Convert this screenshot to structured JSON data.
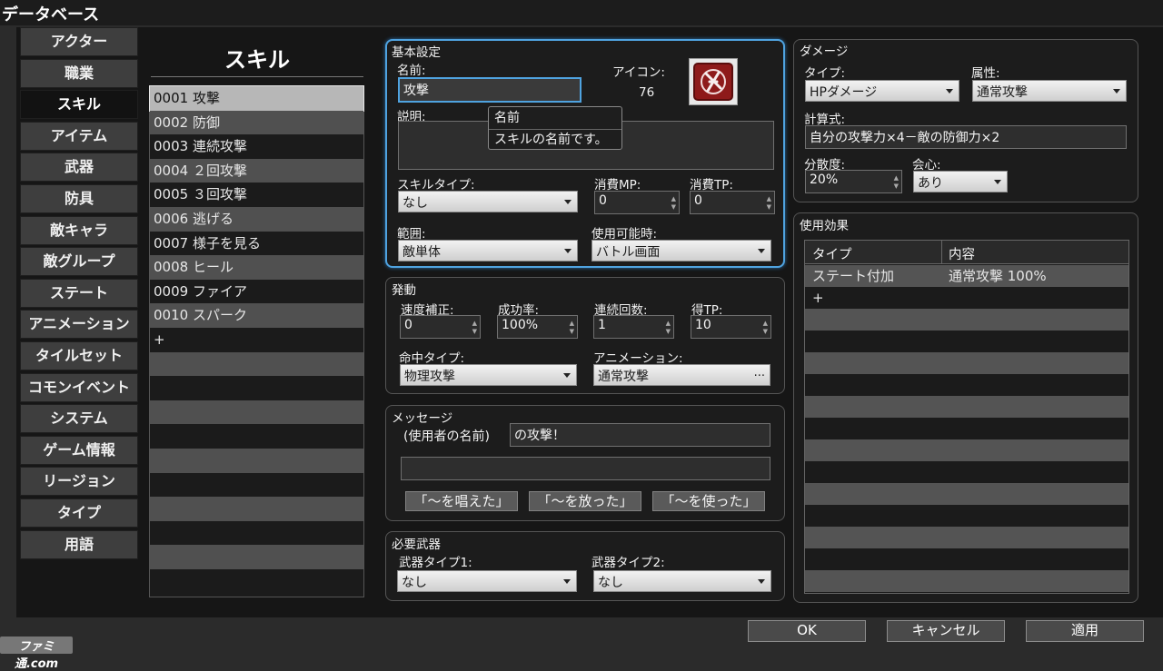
{
  "window": {
    "title": "データベース"
  },
  "sidebar": {
    "selected_index": 2,
    "items": [
      "アクター",
      "職業",
      "スキル",
      "アイテム",
      "武器",
      "防具",
      "敵キャラ",
      "敵グループ",
      "ステート",
      "アニメーション",
      "タイルセット",
      "コモンイベント",
      "システム",
      "ゲーム情報",
      "リージョン",
      "タイプ",
      "用語"
    ]
  },
  "skill_list": {
    "title": "スキル",
    "selected_index": 0,
    "items": [
      "0001 攻撃",
      "0002 防御",
      "0003 連続攻撃",
      "0004 ２回攻撃",
      "0005 ３回攻撃",
      "0006 逃げる",
      "0007 様子を見る",
      "0008 ヒール",
      "0009 ファイア",
      "0010 スパーク"
    ],
    "add_symbol": "+"
  },
  "basic": {
    "section_title": "基本設定",
    "name_label": "名前:",
    "name_value": "攻撃",
    "icon_label": "アイコン:",
    "icon_index": "76",
    "description_label": "説明:",
    "description_value": "",
    "skill_type_label": "スキルタイプ:",
    "skill_type_value": "なし",
    "mp_cost_label": "消費MP:",
    "mp_cost_value": "0",
    "tp_cost_label": "消費TP:",
    "tp_cost_value": "0",
    "scope_label": "範囲:",
    "scope_value": "敵単体",
    "occasion_label": "使用可能時:",
    "occasion_value": "バトル画面"
  },
  "tooltip": {
    "title": "名前",
    "text": "スキルの名前です。"
  },
  "invocation": {
    "section_title": "発動",
    "speed_label": "速度補正:",
    "speed_value": "0",
    "success_label": "成功率:",
    "success_value": "100%",
    "repeats_label": "連続回数:",
    "repeats_value": "1",
    "tp_gain_label": "得TP:",
    "tp_gain_value": "10",
    "hit_type_label": "命中タイプ:",
    "hit_type_value": "物理攻撃",
    "animation_label": "アニメーション:",
    "animation_value": "通常攻撃",
    "ellipsis": "..."
  },
  "message": {
    "section_title": "メッセージ",
    "user_name_label": "(使用者の名前)",
    "line1": "の攻撃！",
    "line2": "",
    "buttons": [
      "「～を唱えた」",
      "「～を放った」",
      "「～を使った」"
    ]
  },
  "weapon": {
    "section_title": "必要武器",
    "type1_label": "武器タイプ1:",
    "type1_value": "なし",
    "type2_label": "武器タイプ2:",
    "type2_value": "なし"
  },
  "damage": {
    "section_title": "ダメージ",
    "type_label": "タイプ:",
    "type_value": "HPダメージ",
    "element_label": "属性:",
    "element_value": "通常攻撃",
    "formula_label": "計算式:",
    "formula_value": "自分の攻撃力×4－敵の防御力×2",
    "variance_label": "分散度:",
    "variance_value": "20%",
    "critical_label": "会心:",
    "critical_value": "あり"
  },
  "effects": {
    "section_title": "使用効果",
    "col_type": "タイプ",
    "col_content": "内容",
    "rows": [
      {
        "type": "ステート付加",
        "content": "通常攻撃 100%"
      }
    ],
    "add_symbol": "+"
  },
  "footer": {
    "ok": "OK",
    "cancel": "キャンセル",
    "apply": "適用"
  },
  "watermark": "ファミ通.com",
  "colors": {
    "focus_blue": "#4fa3e0",
    "selected_row": "#b7b7b7",
    "icon_red": "#8e1a1a"
  }
}
